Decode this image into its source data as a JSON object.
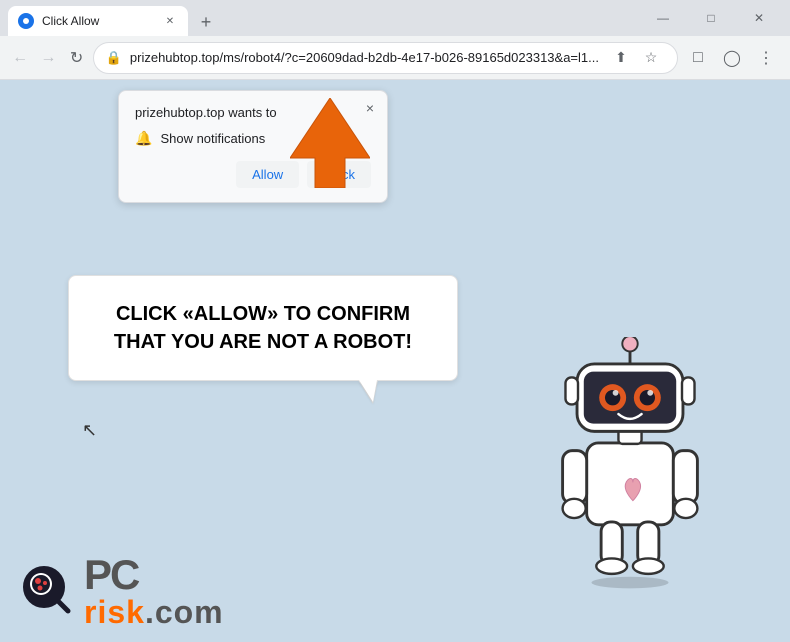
{
  "titlebar": {
    "tab_title": "Click Allow",
    "new_tab_label": "+",
    "minimize": "—",
    "maximize": "□",
    "close": "✕"
  },
  "navbar": {
    "back": "←",
    "forward": "→",
    "refresh": "↻",
    "url": "prizehubtop.top/ms/robot4/?c=20609dad-b2db-4e17-b026-89165d023313&a=l1...",
    "bookmark_icon": "☆",
    "extensions_icon": "□",
    "profile_icon": "◯",
    "menu_icon": "⋮"
  },
  "notification_popup": {
    "title": "prizehubtop.top wants to",
    "close_btn": "×",
    "row_text": "Show notifications",
    "allow_btn": "Allow",
    "block_btn": "Block"
  },
  "speech_bubble": {
    "text": "CLICK «ALLOW» TO CONFIRM THAT YOU ARE NOT A ROBOT!"
  },
  "pcrisk": {
    "logo_text_pc": "PC",
    "logo_text_risk": "risk",
    "logo_text_domain": ".com"
  }
}
